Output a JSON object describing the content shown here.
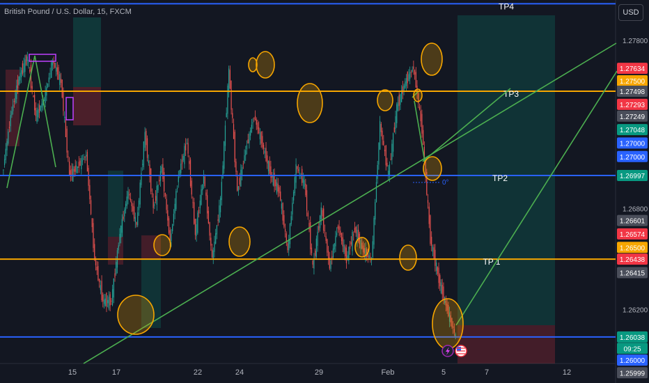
{
  "header": {
    "title": "British Pound / U.S. Dollar, 15, FXCM",
    "currency_button": "USD"
  },
  "chart_data": {
    "type": "line",
    "title": "British Pound / U.S. Dollar, 15, FXCM",
    "x_ticks": [
      "15",
      "17",
      "22",
      "24",
      "29",
      "Feb",
      "5",
      "7",
      "12"
    ],
    "y_ticks": [
      "1.27800",
      "1.26800",
      "1.26200"
    ],
    "ylim": [
      1.2588,
      1.2804
    ],
    "grid": false,
    "level_lines": [
      {
        "label": "TP4",
        "price": 1.28018,
        "color": "#2962ff"
      },
      {
        "label": "TP3",
        "price": 1.27498,
        "color": "#f7a600"
      },
      {
        "label": "TP2",
        "price": 1.26997,
        "color": "#2962ff"
      },
      {
        "label": "TP 1",
        "price": 1.265,
        "color": "#f7a600"
      },
      {
        "label": "",
        "price": 1.26038,
        "color": "#2962ff"
      }
    ],
    "price_labels": [
      {
        "text": "1.27634",
        "price": 1.27634,
        "color": "#f23645"
      },
      {
        "text": "1.27500",
        "price": 1.2756,
        "color": "#f7a600"
      },
      {
        "text": "1.27498",
        "price": 1.27498,
        "color": "#4a4e5a"
      },
      {
        "text": "1.27293",
        "price": 1.2742,
        "color": "#f23645"
      },
      {
        "text": "1.27249",
        "price": 1.2735,
        "color": "#4a4e5a"
      },
      {
        "text": "1.27048",
        "price": 1.2727,
        "color": "#089981"
      },
      {
        "text": "1.27000",
        "price": 1.2719,
        "color": "#2962ff"
      },
      {
        "text": "1.27000",
        "price": 1.2711,
        "color": "#2962ff"
      },
      {
        "text": "1.26997",
        "price": 1.26997,
        "color": "#089981"
      },
      {
        "text": "1.26601",
        "price": 1.2673,
        "color": "#4a4e5a"
      },
      {
        "text": "1.26574",
        "price": 1.2665,
        "color": "#f23645"
      },
      {
        "text": "1.26500",
        "price": 1.2657,
        "color": "#f7a600"
      },
      {
        "text": "1.26438",
        "price": 1.265,
        "color": "#f23645"
      },
      {
        "text": "1.26415",
        "price": 1.2642,
        "color": "#4a4e5a"
      },
      {
        "text": "1.26038",
        "price": 1.26038,
        "color": "#089981"
      },
      {
        "text": "09:25",
        "price": 1.2597,
        "color": "#089981"
      },
      {
        "text": "1.26000",
        "price": 1.259,
        "color": "#2962ff"
      },
      {
        "text": "1.25999",
        "price": 1.25825,
        "color": "#4a4e5a"
      }
    ],
    "annotations": [
      "0°"
    ],
    "price_series": [
      1.27,
      1.2735,
      1.2758,
      1.277,
      1.2735,
      1.2745,
      1.2768,
      1.2755,
      1.27,
      1.2705,
      1.2712,
      1.265,
      1.2625,
      1.2625,
      1.2665,
      1.269,
      1.267,
      1.2725,
      1.268,
      1.2705,
      1.266,
      1.27,
      1.272,
      1.2665,
      1.27,
      1.265,
      1.2685,
      1.2762,
      1.269,
      1.2715,
      1.2735,
      1.2718,
      1.27,
      1.269,
      1.2655,
      1.2705,
      1.2695,
      1.2645,
      1.268,
      1.2645,
      1.267,
      1.265,
      1.2668,
      1.2655,
      1.265,
      1.273,
      1.27,
      1.274,
      1.2755,
      1.2764,
      1.2727,
      1.2662,
      1.2638,
      1.262,
      1.2604
    ]
  }
}
